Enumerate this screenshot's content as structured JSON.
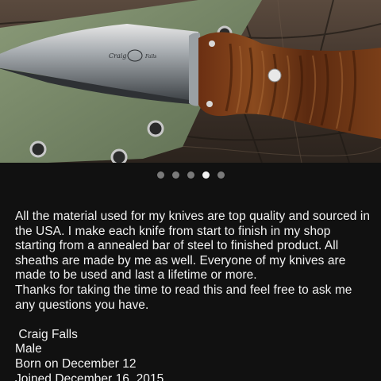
{
  "gallery": {
    "image_alt": "Craig Falls knife with curly maple handle on green kydex sheath",
    "blade_engraving": "Craig",
    "blade_engraving_right": "Falls",
    "dot_count": 5,
    "active_index": 3
  },
  "description": {
    "text": "All the material used for my knives are top quality and sourced in the USA. I make each knife from start to finish in my shop starting from a annealed bar of steel to finished product. All sheaths are made by me as well. Everyone of my knives are made to be used and last a lifetime or more.\n Thanks for taking the time to read this and feel free to ask me any questions you have."
  },
  "profile": {
    "name": " Craig Falls",
    "gender": "Male",
    "birthday": "Born on December 12",
    "joined": "Joined December 16, 2015"
  },
  "colors": {
    "background": "#111111",
    "text": "#f2f2f2",
    "dot_inactive": "#7a7a7a",
    "dot_active": "#f2f2f2"
  }
}
